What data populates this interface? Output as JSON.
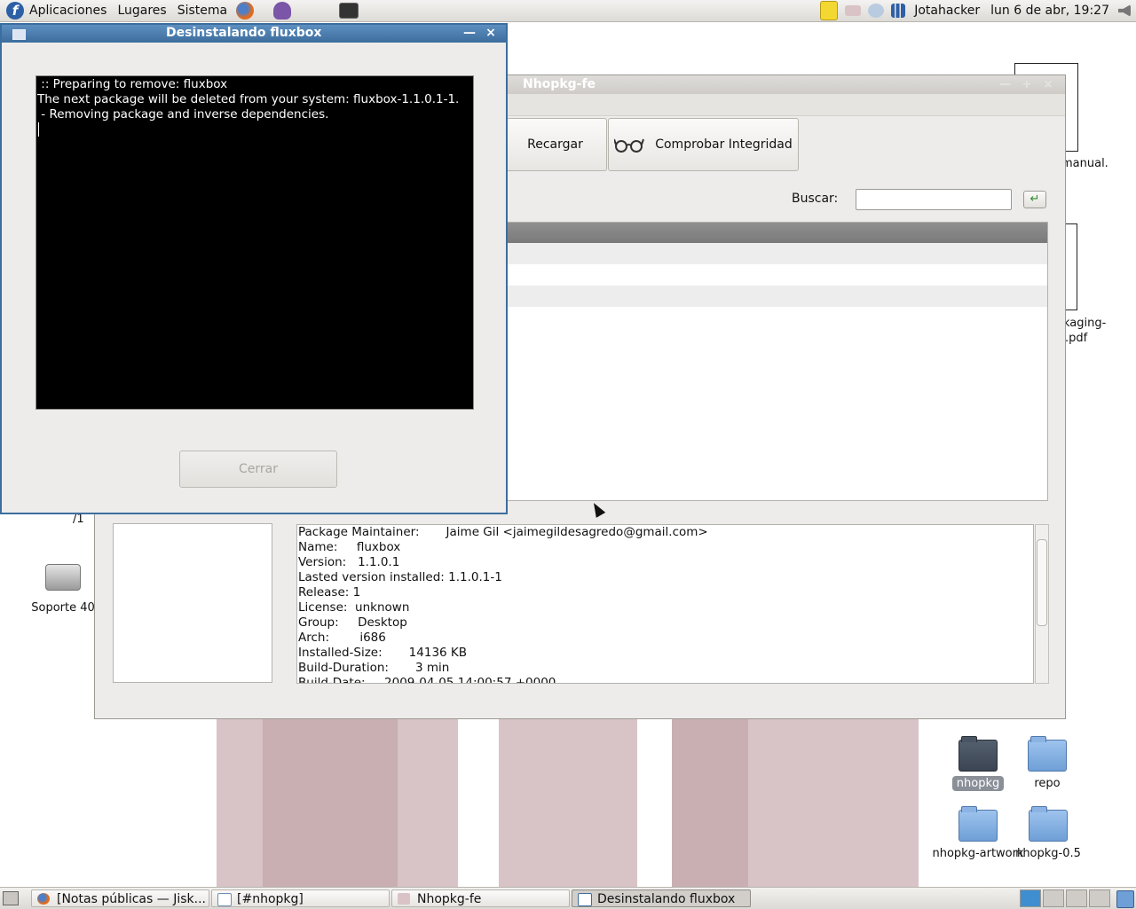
{
  "top_panel": {
    "menus": [
      "Aplicaciones",
      "Lugares",
      "Sistema"
    ],
    "user": "Jotahacker",
    "clock": "lun  6 de abr, 19:27",
    "icons": [
      "fedora-icon",
      "firefox-icon",
      "pidgin-icon",
      "terminal-icon",
      "notes-icon",
      "package-icon",
      "network-icon",
      "signal-icon",
      "volume-icon"
    ]
  },
  "desktop": {
    "icons": [
      {
        "label": "nhopkg",
        "selected": true
      },
      {
        "label": "repo"
      },
      {
        "label": "nhopkg-artwork"
      },
      {
        "label": "nhopkg-0.5"
      },
      {
        "label": "Soporte 40"
      }
    ],
    "partial_labels": [
      "manual.",
      "kaging-",
      ".pdf",
      "/1"
    ]
  },
  "main_window": {
    "title": "Nhopkg-fe",
    "toolbar": {
      "reload": "Recargar",
      "check": "Comprobar Integridad"
    },
    "search": {
      "label": "Buscar:",
      "value": ""
    },
    "info_lines": [
      "Package Maintainer:       Jaime Gil <jaimegildesagredo@gmail.com>",
      "Name:     fluxbox",
      "Version:   1.1.0.1",
      "Lasted version installed: 1.1.0.1-1",
      "Release: 1",
      "License:  unknown",
      "Group:     Desktop",
      "Arch:        i686",
      "Installed-Size:       14136 KB",
      "Build-Duration:       3 min",
      "Build-Date:     2009-04-05 14:00:57 +0000"
    ]
  },
  "dialog": {
    "title": "Desinstalando fluxbox",
    "terminal_lines": [
      " :: Preparing to remove: fluxbox",
      "The next package will be deleted from your system: fluxbox-1.1.0.1-1.",
      " - Removing package and inverse dependencies."
    ],
    "close_button": "Cerrar"
  },
  "taskbar": {
    "tasks": [
      {
        "label": "[Notas públicas — Jisk..."
      },
      {
        "label": "[#nhopkg]"
      },
      {
        "label": "Nhopkg-fe"
      },
      {
        "label": "Desinstalando fluxbox",
        "active": true
      }
    ]
  }
}
